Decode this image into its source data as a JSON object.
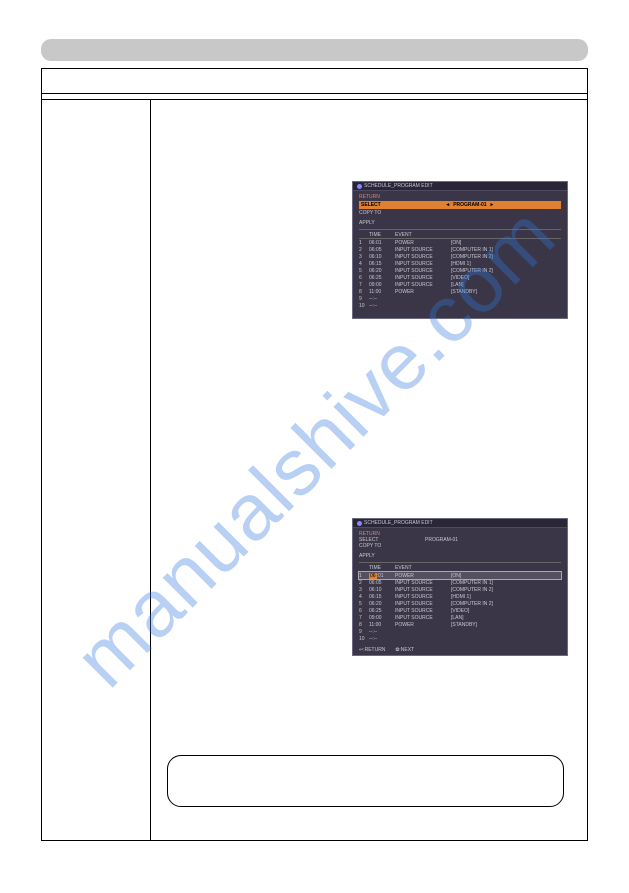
{
  "watermark": "manualshive.com",
  "screen1": {
    "title": "SCHEDULE_PROGRAM EDIT",
    "return": "RETURN",
    "select_label": "SELECT",
    "select_value": "PROGRAM-01",
    "copy_to": "COPY TO",
    "apply": "APPLY",
    "hdr_time": "TIME",
    "hdr_event": "EVENT",
    "rows": [
      {
        "n": "1",
        "t": "06:01",
        "e": "POWER",
        "v": "[ON]"
      },
      {
        "n": "2",
        "t": "06:05",
        "e": "INPUT SOURCE",
        "v": "[COMPUTER IN 1]"
      },
      {
        "n": "3",
        "t": "06:10",
        "e": "INPUT SOURCE",
        "v": "[COMPUTER IN 2]"
      },
      {
        "n": "4",
        "t": "06:15",
        "e": "INPUT SOURCE",
        "v": "[HDMI 1]"
      },
      {
        "n": "5",
        "t": "06:20",
        "e": "INPUT SOURCE",
        "v": "[COMPUTER IN 2]"
      },
      {
        "n": "6",
        "t": "06:25",
        "e": "INPUT SOURCE",
        "v": "[VIDEO]"
      },
      {
        "n": "7",
        "t": "09:00",
        "e": "INPUT SOURCE",
        "v": "[LAN]"
      },
      {
        "n": "8",
        "t": "11:00",
        "e": "POWER",
        "v": "[STANDBY]"
      },
      {
        "n": "9",
        "t": "--:--",
        "e": "",
        "v": ""
      },
      {
        "n": "10",
        "t": "--:--",
        "e": "",
        "v": ""
      }
    ]
  },
  "screen2": {
    "title": "SCHEDULE_PROGRAM EDIT",
    "return": "RETURN",
    "select_label": "SELECT",
    "select_value": "PROGRAM-01",
    "copy_to": "COPY TO",
    "apply": "APPLY",
    "hdr_time": "TIME",
    "hdr_event": "EVENT",
    "rows": [
      {
        "n": "1",
        "hh": "06",
        "mm": "01",
        "e": "POWER",
        "v": "[ON]"
      },
      {
        "n": "2",
        "t": "06:05",
        "e": "INPUT SOURCE",
        "v": "[COMPUTER IN 1]"
      },
      {
        "n": "3",
        "t": "06:10",
        "e": "INPUT SOURCE",
        "v": "[COMPUTER IN 2]"
      },
      {
        "n": "4",
        "t": "06:15",
        "e": "INPUT SOURCE",
        "v": "[HDMI 1]"
      },
      {
        "n": "5",
        "t": "06:20",
        "e": "INPUT SOURCE",
        "v": "[COMPUTER IN 2]"
      },
      {
        "n": "6",
        "t": "06:25",
        "e": "INPUT SOURCE",
        "v": "[VIDEO]"
      },
      {
        "n": "7",
        "t": "09:00",
        "e": "INPUT SOURCE",
        "v": "[LAN]"
      },
      {
        "n": "8",
        "t": "11:00",
        "e": "POWER",
        "v": "[STANDBY]"
      },
      {
        "n": "9",
        "t": "--:--",
        "e": "",
        "v": ""
      },
      {
        "n": "10",
        "t": "--:--",
        "e": "",
        "v": ""
      }
    ],
    "footer_return": "↩:RETURN",
    "footer_next": "⨷:NEXT"
  }
}
